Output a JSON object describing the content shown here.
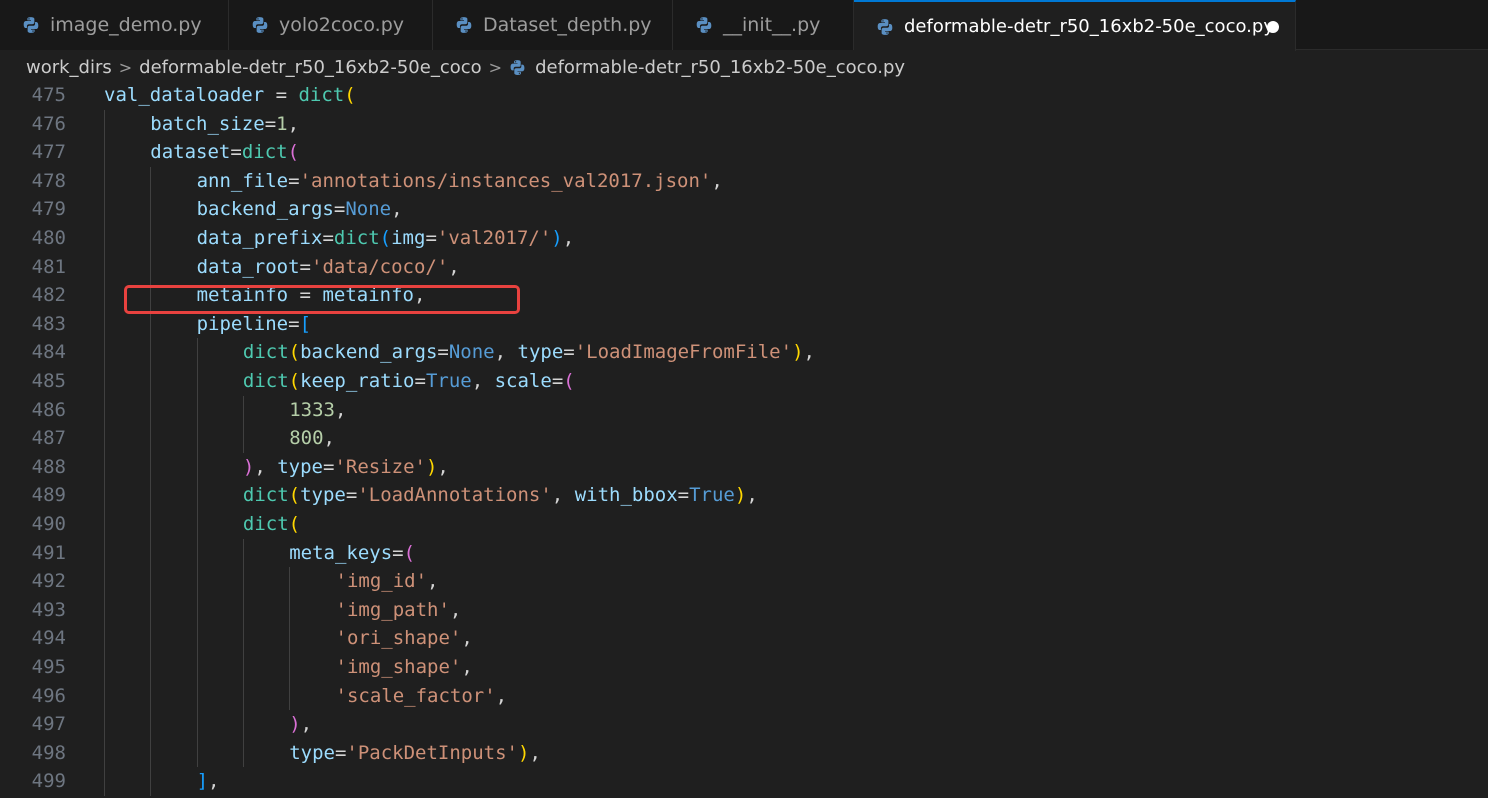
{
  "tabs": [
    {
      "label": "image_demo.py",
      "active": false
    },
    {
      "label": "yolo2coco.py",
      "active": false
    },
    {
      "label": "Dataset_depth.py",
      "active": false
    },
    {
      "label": "__init__.py",
      "active": false
    },
    {
      "label": "deformable-detr_r50_16xb2-50e_coco.py",
      "active": true,
      "unsaved": true
    }
  ],
  "breadcrumb": {
    "folder1": "work_dirs",
    "folder2": "deformable-detr_r50_16xb2-50e_coco",
    "file": "deformable-detr_r50_16xb2-50e_coco.py",
    "separator": ">"
  },
  "colors": {
    "variable": "#9cdcfe",
    "function": "#4ec9b0",
    "string": "#ce9178",
    "number": "#b5cea8",
    "keyword": "#569cd6",
    "highlight_box": "#e8423f"
  },
  "highlighted_line": 482,
  "code_lines": [
    {
      "no": "475",
      "indent": 0,
      "tokens": [
        [
          "v",
          "val_dataloader"
        ],
        [
          "p",
          " = "
        ],
        [
          "f",
          "dict"
        ],
        [
          "b1",
          "("
        ]
      ]
    },
    {
      "no": "476",
      "indent": 1,
      "tokens": [
        [
          "v",
          "batch_size"
        ],
        [
          "p",
          "="
        ],
        [
          "n",
          "1"
        ],
        [
          "p",
          ","
        ]
      ]
    },
    {
      "no": "477",
      "indent": 1,
      "tokens": [
        [
          "v",
          "dataset"
        ],
        [
          "p",
          "="
        ],
        [
          "f",
          "dict"
        ],
        [
          "b2",
          "("
        ]
      ]
    },
    {
      "no": "478",
      "indent": 2,
      "tokens": [
        [
          "v",
          "ann_file"
        ],
        [
          "p",
          "="
        ],
        [
          "s",
          "'annotations/instances_val2017.json'"
        ],
        [
          "p",
          ","
        ]
      ]
    },
    {
      "no": "479",
      "indent": 2,
      "tokens": [
        [
          "v",
          "backend_args"
        ],
        [
          "p",
          "="
        ],
        [
          "k",
          "None"
        ],
        [
          "p",
          ","
        ]
      ]
    },
    {
      "no": "480",
      "indent": 2,
      "tokens": [
        [
          "v",
          "data_prefix"
        ],
        [
          "p",
          "="
        ],
        [
          "f",
          "dict"
        ],
        [
          "b3",
          "("
        ],
        [
          "v",
          "img"
        ],
        [
          "p",
          "="
        ],
        [
          "s",
          "'val2017/'"
        ],
        [
          "b3",
          ")"
        ],
        [
          "p",
          ","
        ]
      ]
    },
    {
      "no": "481",
      "indent": 2,
      "tokens": [
        [
          "v",
          "data_root"
        ],
        [
          "p",
          "="
        ],
        [
          "s",
          "'data/coco/'"
        ],
        [
          "p",
          ","
        ]
      ]
    },
    {
      "no": "482",
      "indent": 2,
      "tokens": [
        [
          "v",
          "metainfo"
        ],
        [
          "p",
          " = "
        ],
        [
          "v",
          "metainfo"
        ],
        [
          "p",
          ","
        ]
      ]
    },
    {
      "no": "483",
      "indent": 2,
      "tokens": [
        [
          "v",
          "pipeline"
        ],
        [
          "p",
          "="
        ],
        [
          "b3",
          "["
        ]
      ]
    },
    {
      "no": "484",
      "indent": 3,
      "tokens": [
        [
          "f",
          "dict"
        ],
        [
          "b1",
          "("
        ],
        [
          "v",
          "backend_args"
        ],
        [
          "p",
          "="
        ],
        [
          "k",
          "None"
        ],
        [
          "p",
          ", "
        ],
        [
          "v",
          "type"
        ],
        [
          "p",
          "="
        ],
        [
          "s",
          "'LoadImageFromFile'"
        ],
        [
          "b1",
          ")"
        ],
        [
          "p",
          ","
        ]
      ]
    },
    {
      "no": "485",
      "indent": 3,
      "tokens": [
        [
          "f",
          "dict"
        ],
        [
          "b1",
          "("
        ],
        [
          "v",
          "keep_ratio"
        ],
        [
          "p",
          "="
        ],
        [
          "k",
          "True"
        ],
        [
          "p",
          ", "
        ],
        [
          "v",
          "scale"
        ],
        [
          "p",
          "="
        ],
        [
          "b2",
          "("
        ]
      ]
    },
    {
      "no": "486",
      "indent": 4,
      "tokens": [
        [
          "n",
          "1333"
        ],
        [
          "p",
          ","
        ]
      ]
    },
    {
      "no": "487",
      "indent": 4,
      "tokens": [
        [
          "n",
          "800"
        ],
        [
          "p",
          ","
        ]
      ]
    },
    {
      "no": "488",
      "indent": 3,
      "tokens": [
        [
          "b2",
          ")"
        ],
        [
          "p",
          ", "
        ],
        [
          "v",
          "type"
        ],
        [
          "p",
          "="
        ],
        [
          "s",
          "'Resize'"
        ],
        [
          "b1",
          ")"
        ],
        [
          "p",
          ","
        ]
      ]
    },
    {
      "no": "489",
      "indent": 3,
      "tokens": [
        [
          "f",
          "dict"
        ],
        [
          "b1",
          "("
        ],
        [
          "v",
          "type"
        ],
        [
          "p",
          "="
        ],
        [
          "s",
          "'LoadAnnotations'"
        ],
        [
          "p",
          ", "
        ],
        [
          "v",
          "with_bbox"
        ],
        [
          "p",
          "="
        ],
        [
          "k",
          "True"
        ],
        [
          "b1",
          ")"
        ],
        [
          "p",
          ","
        ]
      ]
    },
    {
      "no": "490",
      "indent": 3,
      "tokens": [
        [
          "f",
          "dict"
        ],
        [
          "b1",
          "("
        ]
      ]
    },
    {
      "no": "491",
      "indent": 4,
      "tokens": [
        [
          "v",
          "meta_keys"
        ],
        [
          "p",
          "="
        ],
        [
          "b2",
          "("
        ]
      ]
    },
    {
      "no": "492",
      "indent": 5,
      "tokens": [
        [
          "s",
          "'img_id'"
        ],
        [
          "p",
          ","
        ]
      ]
    },
    {
      "no": "493",
      "indent": 5,
      "tokens": [
        [
          "s",
          "'img_path'"
        ],
        [
          "p",
          ","
        ]
      ]
    },
    {
      "no": "494",
      "indent": 5,
      "tokens": [
        [
          "s",
          "'ori_shape'"
        ],
        [
          "p",
          ","
        ]
      ]
    },
    {
      "no": "495",
      "indent": 5,
      "tokens": [
        [
          "s",
          "'img_shape'"
        ],
        [
          "p",
          ","
        ]
      ]
    },
    {
      "no": "496",
      "indent": 5,
      "tokens": [
        [
          "s",
          "'scale_factor'"
        ],
        [
          "p",
          ","
        ]
      ]
    },
    {
      "no": "497",
      "indent": 4,
      "tokens": [
        [
          "b2",
          ")"
        ],
        [
          "p",
          ","
        ]
      ]
    },
    {
      "no": "498",
      "indent": 4,
      "tokens": [
        [
          "v",
          "type"
        ],
        [
          "p",
          "="
        ],
        [
          "s",
          "'PackDetInputs'"
        ],
        [
          "b1",
          ")"
        ],
        [
          "p",
          ","
        ]
      ]
    },
    {
      "no": "499",
      "indent": 2,
      "tokens": [
        [
          "b3",
          "]"
        ],
        [
          "p",
          ","
        ]
      ]
    }
  ]
}
